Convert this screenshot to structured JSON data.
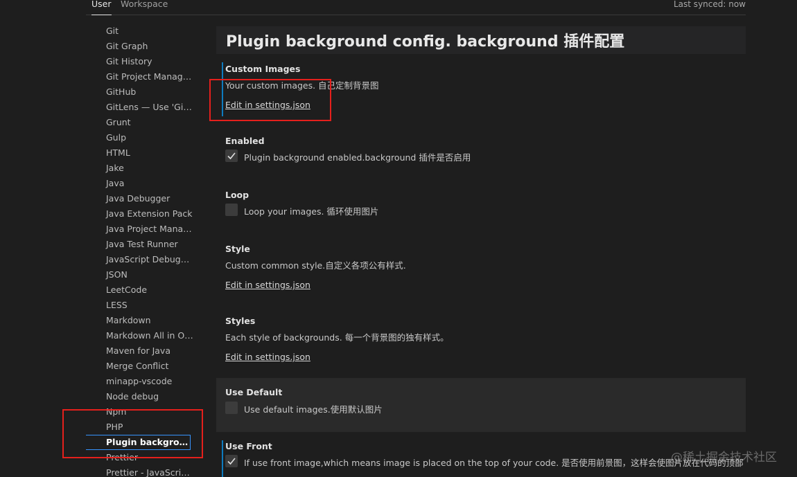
{
  "tabs": {
    "user": "User",
    "workspace": "Workspace",
    "last_synced": "Last synced: now"
  },
  "sidebar": {
    "items": [
      {
        "label": "Git"
      },
      {
        "label": "Git Graph"
      },
      {
        "label": "Git History"
      },
      {
        "label": "Git Project Manage..."
      },
      {
        "label": "GitHub"
      },
      {
        "label": "GitLens — Use 'Git..."
      },
      {
        "label": "Grunt"
      },
      {
        "label": "Gulp"
      },
      {
        "label": "HTML"
      },
      {
        "label": "Jake"
      },
      {
        "label": "Java"
      },
      {
        "label": "Java Debugger"
      },
      {
        "label": "Java Extension Pack"
      },
      {
        "label": "Java Project Manag..."
      },
      {
        "label": "Java Test Runner"
      },
      {
        "label": "JavaScript Debugger"
      },
      {
        "label": "JSON"
      },
      {
        "label": "LeetCode"
      },
      {
        "label": "LESS"
      },
      {
        "label": "Markdown"
      },
      {
        "label": "Markdown All in One"
      },
      {
        "label": "Maven for Java"
      },
      {
        "label": "Merge Conflict"
      },
      {
        "label": "minapp-vscode"
      },
      {
        "label": "Node debug"
      },
      {
        "label": "Npm"
      },
      {
        "label": "PHP"
      },
      {
        "label": "Plugin backgroun..."
      },
      {
        "label": "Prettier"
      },
      {
        "label": "Prettier - JavaScript..."
      }
    ],
    "selected_index": 27
  },
  "main": {
    "title": "Plugin background config. background 插件配置",
    "settings": {
      "custom_images": {
        "title": "Custom Images",
        "desc": "Your custom images. 自己定制背景图",
        "link": "Edit in settings.json"
      },
      "enabled": {
        "title": "Enabled",
        "label": "Plugin background enabled.background 插件是否启用",
        "checked": true
      },
      "loop": {
        "title": "Loop",
        "label": "Loop your images. 循环使用图片",
        "checked": false
      },
      "style": {
        "title": "Style",
        "desc": "Custom common style.自定义各项公有样式.",
        "link": "Edit in settings.json"
      },
      "styles": {
        "title": "Styles",
        "desc": "Each style of backgrounds. 每一个背景图的独有样式。",
        "link": "Edit in settings.json"
      },
      "use_default": {
        "title": "Use Default",
        "label": "Use default images.使用默认图片",
        "checked": false
      },
      "use_front": {
        "title": "Use Front",
        "label": "If use front image,which means image is placed on the top of your code. 是否使用前景图，这样会使图片放在代码的顶部",
        "checked": true
      }
    }
  },
  "watermark": "@稀土掘金技术社区",
  "colors": {
    "background": "#1e1e1e",
    "focus_accent": "#0e7bbf",
    "selection_border": "#3794ff",
    "annotation_red": "#e5201c"
  }
}
